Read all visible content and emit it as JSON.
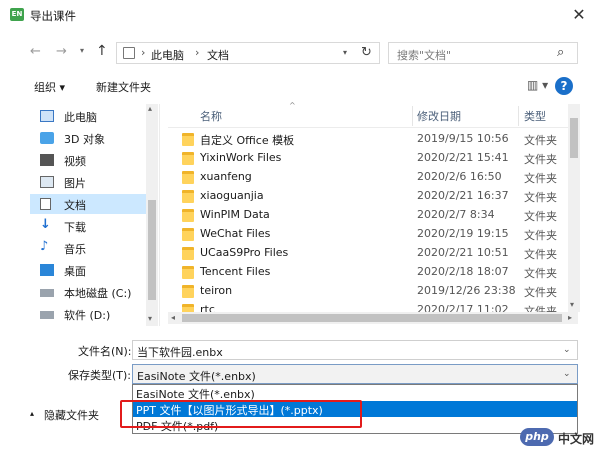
{
  "window": {
    "title": "导出课件",
    "app_icon": "EN",
    "close": "✕"
  },
  "nav": {
    "back": "←",
    "forward": "→",
    "up": "↑",
    "path": [
      "此电脑",
      "文档"
    ],
    "path_separator": "›",
    "refresh": "↻",
    "search_placeholder": "搜索\"文档\""
  },
  "toolbar": {
    "organize": "组织 ▾",
    "new_folder": "新建文件夹",
    "view_icon": "▥ ▾",
    "help": "?"
  },
  "sidebar": {
    "items": [
      {
        "label": "此电脑",
        "icon": "pc-icon"
      },
      {
        "label": "3D 对象",
        "icon": "3d-objects-icon"
      },
      {
        "label": "视频",
        "icon": "video-icon"
      },
      {
        "label": "图片",
        "icon": "pictures-icon"
      },
      {
        "label": "文档",
        "icon": "documents-icon",
        "selected": true
      },
      {
        "label": "下载",
        "icon": "download-icon"
      },
      {
        "label": "音乐",
        "icon": "music-icon"
      },
      {
        "label": "桌面",
        "icon": "desktop-icon"
      },
      {
        "label": "本地磁盘 (C:)",
        "icon": "drive-icon"
      },
      {
        "label": "软件 (D:)",
        "icon": "drive-icon"
      }
    ]
  },
  "columns": {
    "name": "名称",
    "date": "修改日期",
    "type": "类型"
  },
  "files": [
    {
      "name": "自定义 Office 模板",
      "date": "2019/9/15 10:56",
      "type": "文件夹"
    },
    {
      "name": "YixinWork Files",
      "date": "2020/2/21 15:41",
      "type": "文件夹"
    },
    {
      "name": "xuanfeng",
      "date": "2020/2/6 16:50",
      "type": "文件夹"
    },
    {
      "name": "xiaoguanjia",
      "date": "2020/2/21 16:37",
      "type": "文件夹"
    },
    {
      "name": "WinPIM Data",
      "date": "2020/2/7 8:34",
      "type": "文件夹"
    },
    {
      "name": "WeChat Files",
      "date": "2020/2/19 19:15",
      "type": "文件夹"
    },
    {
      "name": "UCaaS9Pro Files",
      "date": "2020/2/21 10:51",
      "type": "文件夹"
    },
    {
      "name": "Tencent Files",
      "date": "2020/2/18 18:07",
      "type": "文件夹"
    },
    {
      "name": "teiron",
      "date": "2019/12/26 23:38",
      "type": "文件夹"
    },
    {
      "name": "rtc",
      "date": "2020/2/17 11:02",
      "type": "文件夹"
    }
  ],
  "form": {
    "filename_label": "文件名(N):",
    "filename_value": "当下软件园.enbx",
    "filetype_label": "保存类型(T):",
    "filetype_value": "EasiNote 文件(*.enbx)",
    "options": [
      "EasiNote 文件(*.enbx)",
      "PPT 文件【以图片形式导出】(*.pptx)",
      "PDF 文件(*.pdf)"
    ]
  },
  "footer": {
    "hide_folders": "隐藏文件夹"
  },
  "watermark": {
    "logo": "php",
    "text": "中文网"
  },
  "colors": {
    "selection": "#cce8ff",
    "highlight": "#0078d7",
    "annotation": "#e21b1b",
    "folder": "#ffd35c"
  }
}
